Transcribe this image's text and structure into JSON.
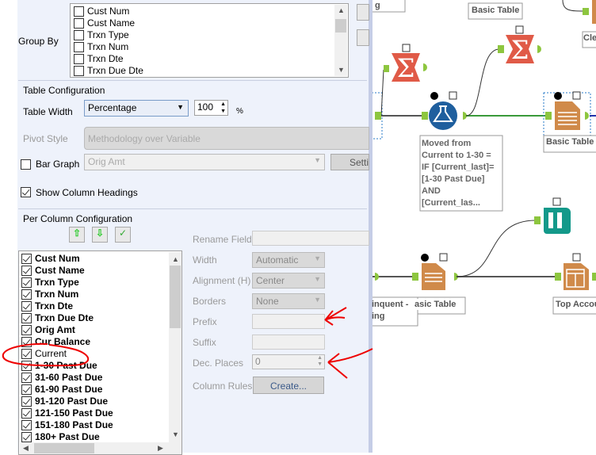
{
  "group_by": {
    "label": "Group By",
    "fields": [
      "Cust Num",
      "Cust Name",
      "Trxn Type",
      "Trxn Num",
      "Trxn Dte",
      "Trxn Due Dte"
    ]
  },
  "table_config": {
    "title": "Table Configuration",
    "width_label": "Table Width",
    "width_mode": "Percentage",
    "width_value": "100",
    "unit": "%",
    "pivot_label": "Pivot Style",
    "pivot_value": "Methodology over Variable",
    "bar_graph_label": "Bar Graph",
    "bar_graph_checked": false,
    "bar_graph_field": "Orig Amt",
    "settings_label": "Setti",
    "show_headings_label": "Show Column Headings",
    "show_headings_checked": true
  },
  "per_column": {
    "title": "Per Column Configuration",
    "columns": [
      {
        "name": "Cust Num",
        "bold": true
      },
      {
        "name": "Cust Name",
        "bold": true
      },
      {
        "name": "Trxn Type",
        "bold": true
      },
      {
        "name": "Trxn Num",
        "bold": true
      },
      {
        "name": "Trxn Dte",
        "bold": true
      },
      {
        "name": "Trxn Due Dte",
        "bold": true
      },
      {
        "name": "Orig Amt",
        "bold": true
      },
      {
        "name": "Cur Balance",
        "bold": true
      },
      {
        "name": "Current",
        "bold": false
      },
      {
        "name": "1-30 Past Due",
        "bold": true
      },
      {
        "name": "31-60 Past Due",
        "bold": true
      },
      {
        "name": "61-90 Past Due",
        "bold": true
      },
      {
        "name": "91-120 Past Due",
        "bold": true
      },
      {
        "name": "121-150 Past Due",
        "bold": true
      },
      {
        "name": "151-180 Past Due",
        "bold": true
      },
      {
        "name": "180+ Past Due",
        "bold": true
      }
    ],
    "rename_label": "Rename Field",
    "rename_value": "",
    "width_label": "Width",
    "width_value": "Automatic",
    "align_label": "Alignment (H)",
    "align_value": "Center",
    "borders_label": "Borders",
    "borders_value": "None",
    "prefix_label": "Prefix",
    "prefix_value": "",
    "suffix_label": "Suffix",
    "suffix_value": "",
    "dec_label": "Dec. Places",
    "dec_value": "0",
    "rules_label": "Column Rules",
    "create_label": "Create..."
  },
  "canvas": {
    "labels": {
      "top_partial": "g",
      "basic_table_top": "Basic Table",
      "clean_partial": "Cle",
      "basic_table_mid": "Basic Table",
      "annotation": [
        "Moved from",
        "Current to 1-30 =",
        "IF [Current_last]=",
        "[1-30 Past Due]",
        "AND",
        "[Current_las..."
      ],
      "delinquent": "inquent -",
      "delinquent2": "ing",
      "basic_table_bottom": "asic Table",
      "top_accounts": "Top Accou"
    },
    "colors": {
      "summarize": "#e05a47",
      "formula": "#1f5f9e",
      "table": "#d08a4a",
      "browse": "#13998a",
      "connector": "#8dc63f",
      "annotation_red": "#e00000"
    }
  }
}
